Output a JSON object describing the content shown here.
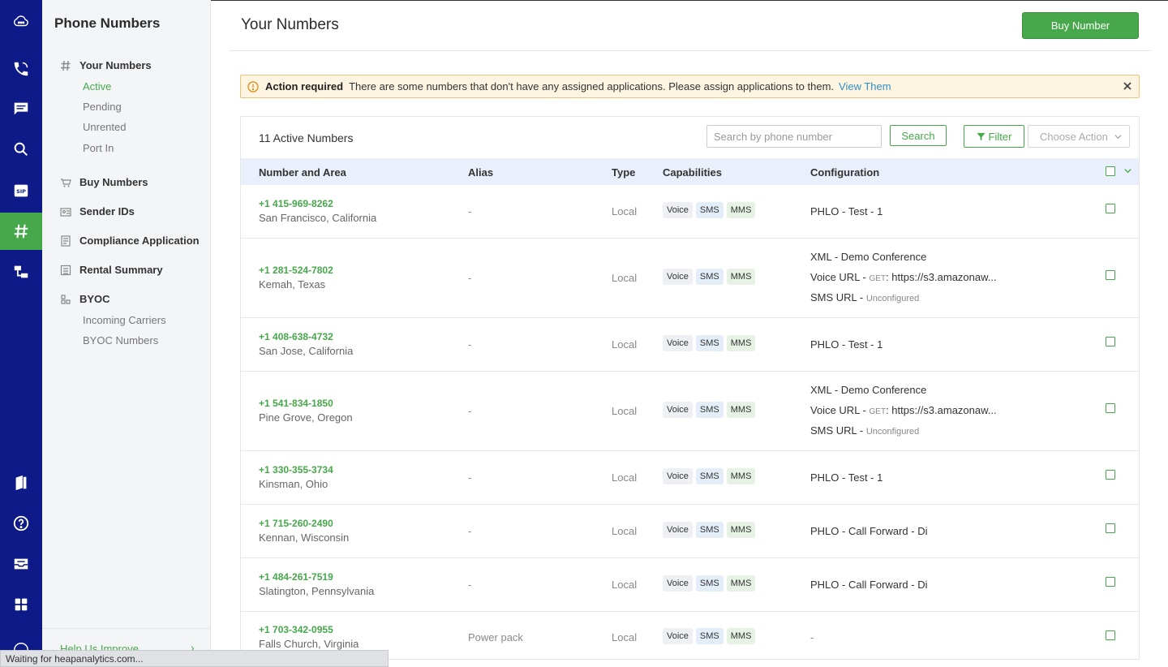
{
  "sidebar": {
    "title": "Phone Numbers",
    "your_numbers": "Your Numbers",
    "active": "Active",
    "pending": "Pending",
    "unrented": "Unrented",
    "port_in": "Port In",
    "buy_numbers": "Buy Numbers",
    "sender_ids": "Sender IDs",
    "compliance": "Compliance Application",
    "rental_summary": "Rental Summary",
    "byoc": "BYOC",
    "incoming_carriers": "Incoming Carriers",
    "byoc_numbers": "BYOC Numbers",
    "help": "Help Us Improve"
  },
  "header": {
    "title": "Your Numbers",
    "buy_number": "Buy Number"
  },
  "alert": {
    "title": "Action required",
    "message": "There are some numbers that don't have any assigned applications. Please assign applications to them.",
    "link": "View Them"
  },
  "toolbar": {
    "count": "11 Active Numbers",
    "search_placeholder": "Search by phone number",
    "search": "Search",
    "filter": "Filter",
    "choose_action": "Choose Action"
  },
  "table": {
    "columns": [
      "Number and Area",
      "Alias",
      "Type",
      "Capabilities",
      "Configuration"
    ],
    "caps": [
      "Voice",
      "SMS",
      "MMS"
    ],
    "rows": [
      {
        "number": "+1 415-969-8262",
        "area": "San Francisco, California",
        "alias": "-",
        "type": "Local",
        "config": "PHLO - Test - 1"
      },
      {
        "number": "+1 281-524-7802",
        "area": "Kemah, Texas",
        "alias": "-",
        "type": "Local",
        "config": "XML - Demo Conference",
        "voice_label": "Voice URL - ",
        "method": "GET",
        "voice_url": ": https://s3.amazonaw...",
        "sms_label": "SMS URL - ",
        "sms_value": "Unconfigured"
      },
      {
        "number": "+1 408-638-4732",
        "area": "San Jose, California",
        "alias": "-",
        "type": "Local",
        "config": "PHLO - Test - 1"
      },
      {
        "number": "+1 541-834-1850",
        "area": "Pine Grove, Oregon",
        "alias": "-",
        "type": "Local",
        "config": "XML - Demo Conference",
        "voice_label": "Voice URL - ",
        "method": "GET",
        "voice_url": ": https://s3.amazonaw...",
        "sms_label": "SMS URL - ",
        "sms_value": "Unconfigured"
      },
      {
        "number": "+1 330-355-3734",
        "area": "Kinsman, Ohio",
        "alias": "-",
        "type": "Local",
        "config": "PHLO - Test - 1"
      },
      {
        "number": "+1 715-260-2490",
        "area": "Kennan, Wisconsin",
        "alias": "-",
        "type": "Local",
        "config": "PHLO - Call Forward - Di"
      },
      {
        "number": "+1 484-261-7519",
        "area": "Slatington, Pennsylvania",
        "alias": "-",
        "type": "Local",
        "config": "PHLO - Call Forward - Di"
      },
      {
        "number": "+1 703-342-0955",
        "area": "Falls Church, Virginia",
        "alias": "Power pack",
        "type": "Local",
        "config": "-"
      }
    ]
  },
  "status_bar": "Waiting for heapanalytics.com...",
  "colors": {
    "rail": "#0e1a87",
    "accent": "#46a84a",
    "link": "#2f8fc2",
    "alert_bg": "#fdf5e1"
  }
}
